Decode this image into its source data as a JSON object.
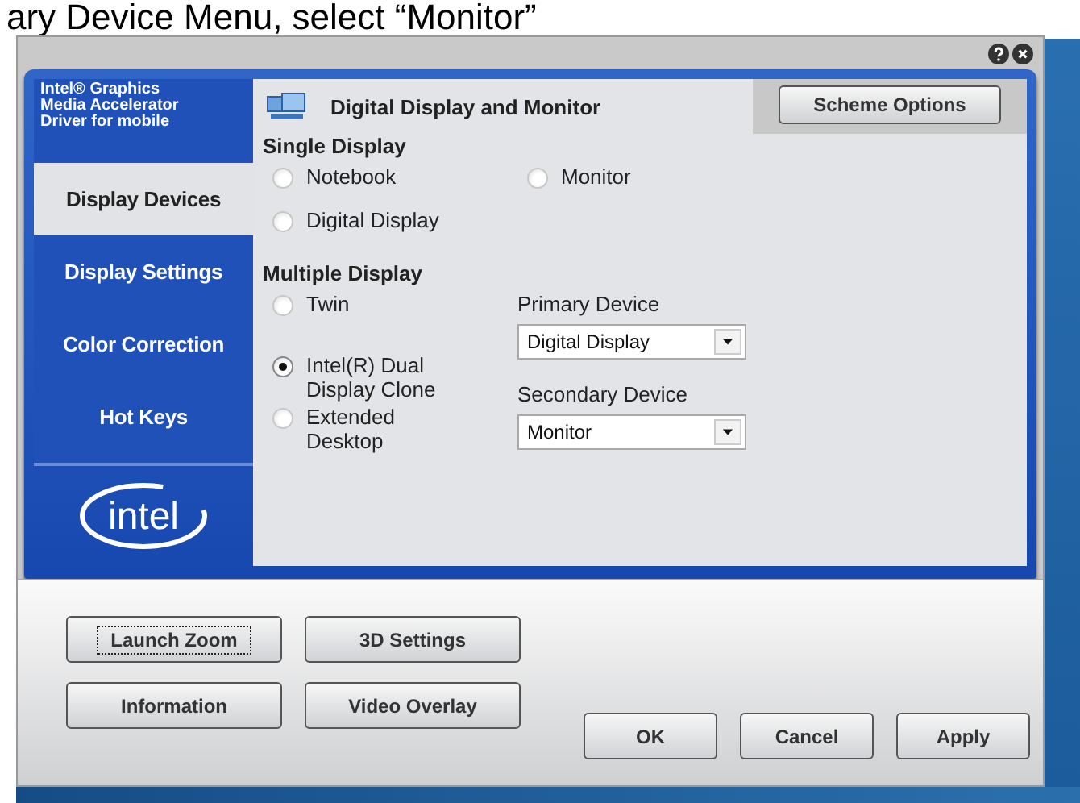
{
  "caption": "ary Device Menu, select “Monitor”",
  "sidebar": {
    "header": "Intel® Graphics Media Accelerator Driver for mobile",
    "items": [
      {
        "label": "Display Devices",
        "selected": true
      },
      {
        "label": "Display Settings",
        "selected": false
      },
      {
        "label": "Color Correction",
        "selected": false
      },
      {
        "label": "Hot Keys",
        "selected": false
      }
    ],
    "logo": "intel"
  },
  "panel": {
    "title": "Digital Display and Monitor",
    "scheme_button": "Scheme Options",
    "single_display": {
      "heading": "Single Display",
      "options": [
        {
          "label": "Notebook",
          "selected": false
        },
        {
          "label": "Monitor",
          "selected": false
        },
        {
          "label": "Digital Display",
          "selected": false
        }
      ]
    },
    "multiple_display": {
      "heading": "Multiple Display",
      "options": [
        {
          "label": "Twin",
          "selected": false
        },
        {
          "label": "Intel(R) Dual Display Clone",
          "selected": true
        },
        {
          "label": "Extended Desktop",
          "selected": false
        }
      ]
    },
    "primary_device": {
      "label": "Primary Device",
      "value": "Digital Display"
    },
    "secondary_device": {
      "label": "Secondary Device",
      "value": "Monitor"
    }
  },
  "tool_buttons": [
    {
      "label": "Launch Zoom",
      "focused": true
    },
    {
      "label": "3D Settings",
      "focused": false
    },
    {
      "label": "Information",
      "focused": false
    },
    {
      "label": "Video Overlay",
      "focused": false
    }
  ],
  "dialog_buttons": [
    "OK",
    "Cancel",
    "Apply"
  ]
}
